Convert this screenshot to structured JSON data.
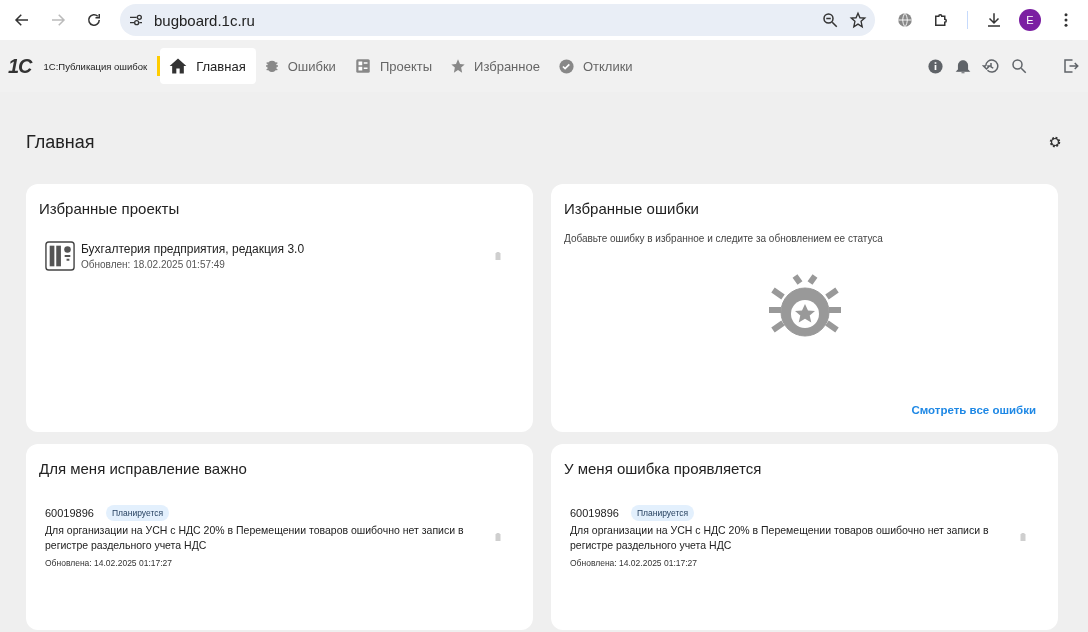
{
  "browser": {
    "url": "bugboard.1c.ru",
    "back_disabled": false,
    "forward_disabled": true,
    "profile": "E"
  },
  "app": {
    "logo": "1С",
    "name": "1С:Публикация ошибок",
    "tabs": [
      {
        "label": "Главная",
        "kind": "home",
        "selected": true
      },
      {
        "label": "Ошибки",
        "kind": "bug",
        "selected": false
      },
      {
        "label": "Проекты",
        "kind": "projects",
        "selected": false
      },
      {
        "label": "Избранное",
        "kind": "star",
        "selected": false
      },
      {
        "label": "Отклики",
        "kind": "check",
        "selected": false
      }
    ]
  },
  "page": {
    "title": "Главная"
  },
  "favorite_projects": {
    "title": "Избранные проекты",
    "items": [
      {
        "name": "Бухгалтерия предприятия, редакция 3.0",
        "updated": "Обновлен: 18.02.2025 01:57:49"
      }
    ]
  },
  "favorite_bugs": {
    "title": "Избранные ошибки",
    "hint": "Добавьте ошибку в избранное и следите за обновлением ее статуса",
    "link": "Смотреть все ошибки"
  },
  "bug_lists": [
    {
      "title": "Для меня исправление важно",
      "items": [
        {
          "id": "60019896",
          "status": "Планируется",
          "text": "Для организации на УСН с НДС 20% в Перемещении товаров ошибочно нет записи в регистре раздельного учета НДС",
          "updated": "Обновлена: 14.02.2025 01:17:27"
        }
      ]
    },
    {
      "title": "У меня ошибка проявляется",
      "items": [
        {
          "id": "60019896",
          "status": "Планируется",
          "text": "Для организации на УСН с НДС 20% в Перемещении товаров ошибочно нет записи в регистре раздельного учета НДС",
          "updated": "Обновлена: 14.02.2025 01:17:27"
        }
      ]
    }
  ]
}
